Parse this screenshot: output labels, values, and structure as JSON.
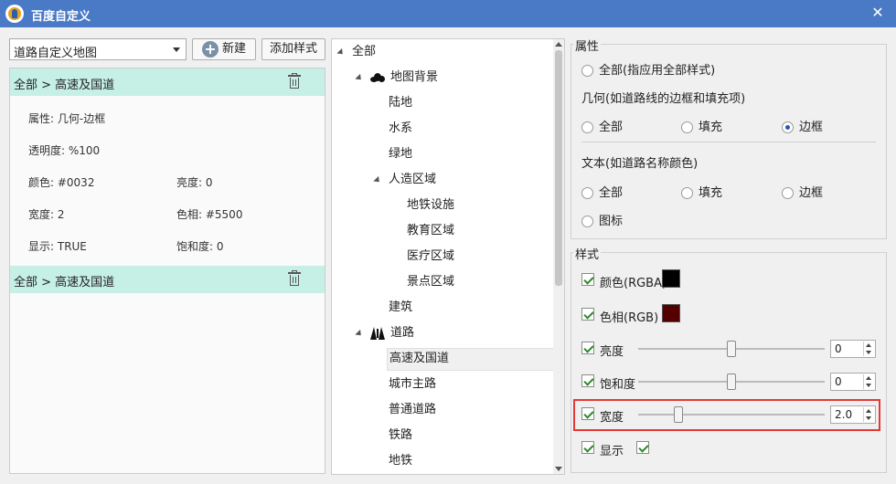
{
  "window": {
    "title": "百度自定义",
    "close": "✕"
  },
  "left": {
    "select_value": "道路自定义地图",
    "new_btn": "新建",
    "new_btn_icon": "+",
    "add_btn": "添加样式",
    "groups": [
      {
        "title": "全部 > 高速及国道"
      },
      {
        "title": "全部 > 高速及国道"
      }
    ],
    "props": {
      "attr": "属性:  几何-边框",
      "opacity": "透明度:  %100",
      "color": "颜色:  #0032",
      "brightness": "亮度:  0",
      "width": "宽度:  2",
      "hue": "色相:  #5500",
      "display": "显示:  TRUE",
      "saturation": "饱和度:  0"
    }
  },
  "tree": {
    "items": [
      {
        "label": "全部"
      },
      {
        "label": "地图背景"
      },
      {
        "label": "陆地"
      },
      {
        "label": "水系"
      },
      {
        "label": "绿地"
      },
      {
        "label": "人造区域"
      },
      {
        "label": "地铁设施"
      },
      {
        "label": "教育区域"
      },
      {
        "label": "医疗区域"
      },
      {
        "label": "景点区域"
      },
      {
        "label": "建筑"
      },
      {
        "label": "道路"
      },
      {
        "label": "高速及国道"
      },
      {
        "label": "城市主路"
      },
      {
        "label": "普通道路"
      },
      {
        "label": "铁路"
      },
      {
        "label": "地铁"
      }
    ]
  },
  "attr_panel": {
    "legend": "属性",
    "all_styles": "全部(指应用全部样式)",
    "geometry_label": "几何(如道路线的边框和填充项)",
    "geometry_options": [
      "全部",
      "填充",
      "边框"
    ],
    "geometry_selected": "边框",
    "text_label": "文本(如道路名称颜色)",
    "text_options": [
      "全部",
      "填充",
      "边框",
      "图标"
    ]
  },
  "style_panel": {
    "legend": "样式",
    "color_label": "颜色(RGBA)",
    "color_value": "#000000",
    "hue_label": "色相(RGB)",
    "hue_value": "#550000",
    "brightness_label": "亮度",
    "brightness_value": "0",
    "brightness_level": 0.5,
    "saturation_label": "饱和度",
    "saturation_value": "0",
    "saturation_level": 0.5,
    "width_label": "宽度",
    "width_value": "2.0",
    "width_level": 0.2,
    "display_label": "显示",
    "highlight_color": "#e53935"
  }
}
